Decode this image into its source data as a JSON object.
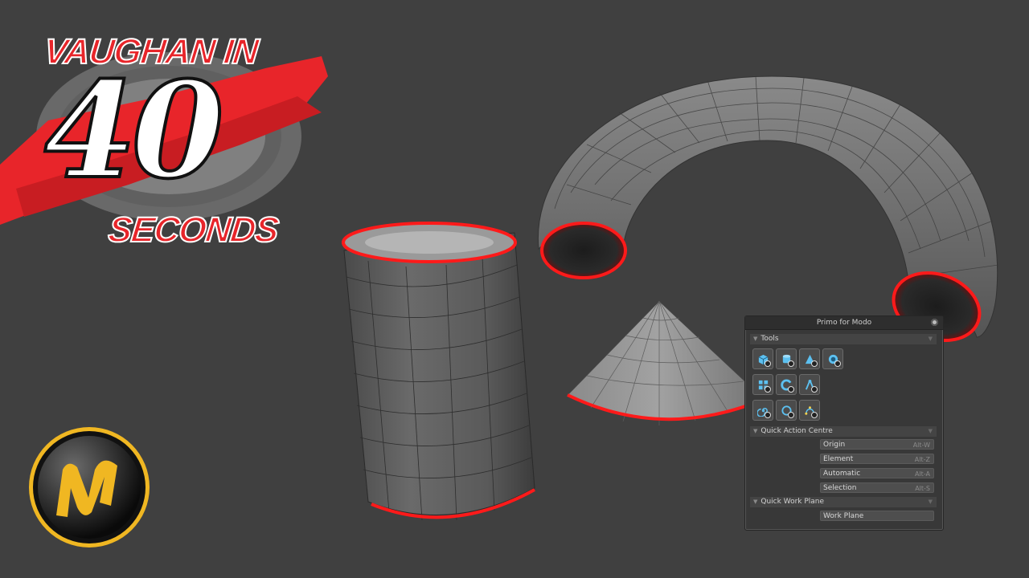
{
  "logo": {
    "line1": "VAUGHAN IN",
    "number": "40",
    "line2": "SECONDS",
    "red": "#e8252a"
  },
  "brand_badge": {
    "icon": "modo-logo-icon",
    "color": "#f0b722"
  },
  "panel": {
    "title": "Primo for Modo",
    "close_icon": "circle-close-icon",
    "sections": {
      "tools": "Tools",
      "quick_action": "Quick Action Centre",
      "quick_work_plane": "Quick Work Plane"
    },
    "tool_rows": [
      [
        "cube-icon",
        "cylinder-icon",
        "cone-icon",
        "sphere-icon"
      ],
      [
        "grid-plane-icon",
        "torus-arc-icon",
        "compass-icon"
      ],
      [
        "spiral-icon",
        "ring-icon",
        "curve-icon"
      ]
    ],
    "quick_actions": [
      {
        "label": "Origin",
        "shortcut": "Alt-W"
      },
      {
        "label": "Element",
        "shortcut": "Alt-Z"
      },
      {
        "label": "Automatic",
        "shortcut": "Alt-A"
      },
      {
        "label": "Selection",
        "shortcut": "Alt-S"
      }
    ],
    "work_plane": {
      "label": "Work Plane"
    }
  },
  "colors": {
    "viewport_bg": "#404040",
    "mesh_gray": "#6e6e6e",
    "edge_highlight": "#ff1a1a",
    "icon_blue": "#5cc0f0"
  }
}
